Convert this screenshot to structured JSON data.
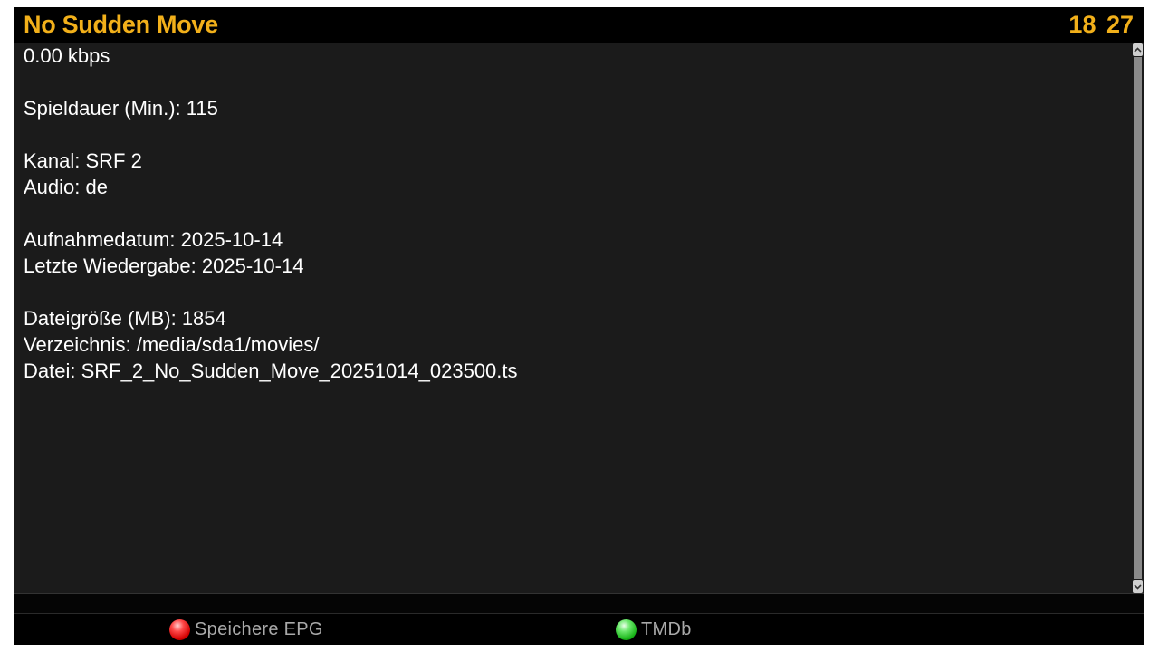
{
  "header": {
    "title": "No Sudden Move",
    "clock": "18 27"
  },
  "info": {
    "text": "0.00 kbps\n\nSpieldauer (Min.): 115\n\nKanal: SRF 2\nAudio: de\n\nAufnahmedatum: 2025-10-14\nLetzte Wiedergabe: 2025-10-14\n\nDateigröße (MB): 1854\nVerzeichnis: /media/sda1/movies/\nDatei: SRF_2_No_Sudden_Move_20251014_023500.ts"
  },
  "footer": {
    "red_key": {
      "label": "Speichere EPG",
      "icon": "red-button-icon",
      "color": "#e00000"
    },
    "green_key": {
      "label": "TMDb",
      "icon": "green-button-icon",
      "color": "#22c022"
    }
  },
  "theme": {
    "accent": "#f2b01a",
    "background": "#1b1b1b",
    "text": "#ffffff"
  }
}
